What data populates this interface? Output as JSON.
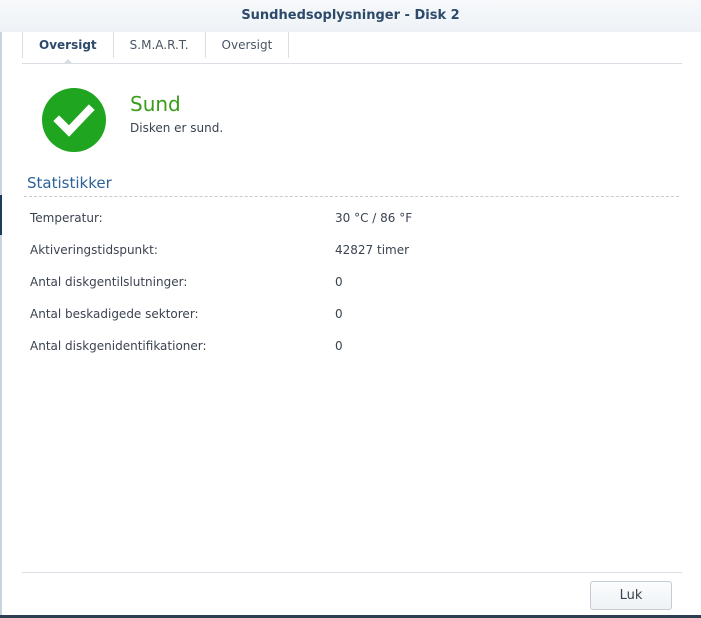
{
  "window": {
    "title": "Sundhedsoplysninger - Disk 2"
  },
  "tabs": [
    {
      "label": "Oversigt",
      "active": true
    },
    {
      "label": "S.M.A.R.T."
    },
    {
      "label": "Oversigt"
    }
  ],
  "status": {
    "icon": "check-circle-icon",
    "title": "Sund",
    "description": "Disken er sund.",
    "color": "#1fa51f"
  },
  "statistics": {
    "heading": "Statistikker",
    "rows": [
      {
        "label": "Temperatur:",
        "value": "30 °C / 86 °F"
      },
      {
        "label": "Aktiveringstidspunkt:",
        "value": "42827 timer"
      },
      {
        "label": "Antal diskgentilslutninger:",
        "value": "0"
      },
      {
        "label": "Antal beskadigede sektorer:",
        "value": "0"
      },
      {
        "label": "Antal diskgenidentifikationer:",
        "value": "0"
      }
    ]
  },
  "footer": {
    "close_label": "Luk"
  }
}
